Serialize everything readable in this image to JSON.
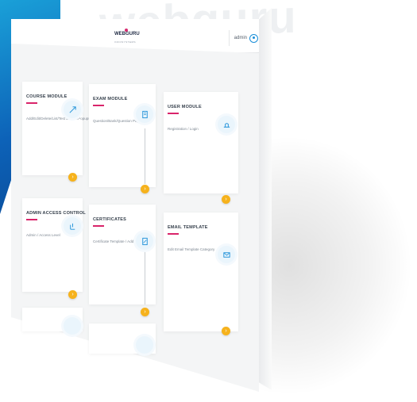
{
  "background": {
    "watermark": "webguru",
    "accent_color": "#0d62b8"
  },
  "header": {
    "logo_main": "WEBGURU",
    "logo_sub": "INFOSYSTEMS",
    "user_name": "admin"
  },
  "cards": [
    {
      "title": "COURSE MODULE",
      "desc": "Add/Edit/Delete/List/Test Details/Popups",
      "icon": "upload-icon"
    },
    {
      "title": "EXAM MODULE",
      "desc": "Question/Bank/Question Papers",
      "icon": "exam-doc-icon"
    },
    {
      "title": "USER MODULE",
      "desc": "Registration / Login",
      "icon": "user-hand-icon"
    },
    {
      "title": "ADMIN ACCESS CONTROL",
      "desc": "Admin / Access Level",
      "icon": "access-control-icon"
    },
    {
      "title": "CERTIFICATES",
      "desc": "Certificate Template / Add",
      "icon": "certificate-icon"
    },
    {
      "title": "EMAIL TEMPLATE",
      "desc": "Edit Email Template Category",
      "icon": "email-icon"
    },
    {
      "title": "",
      "desc": "",
      "icon": "module-icon"
    },
    {
      "title": "",
      "desc": "",
      "icon": "module-icon"
    }
  ],
  "colors": {
    "button": "#f6b21c",
    "title_underline": "#d9246a",
    "icon": "#1b8fd8"
  }
}
